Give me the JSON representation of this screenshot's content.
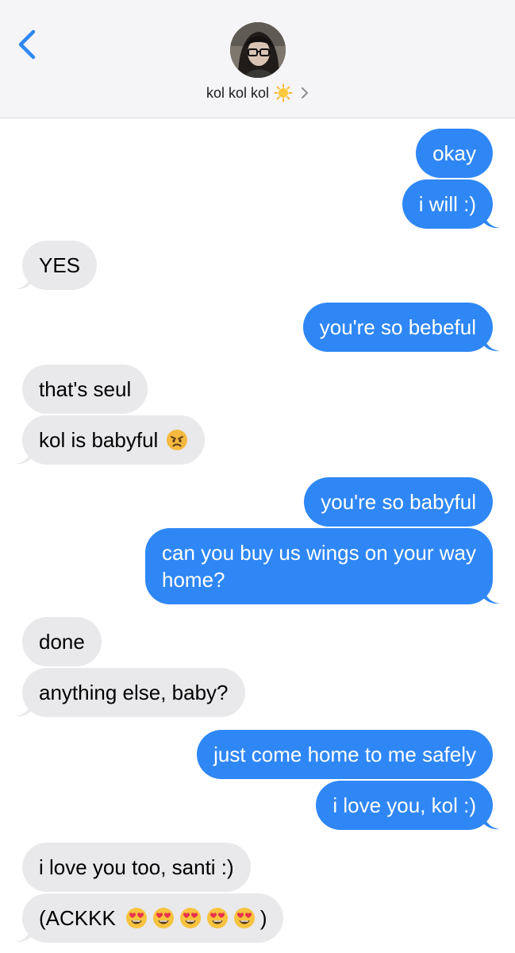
{
  "header": {
    "contact_name": "kol kol kol",
    "contact_emoji": "sun-icon",
    "back_icon": "chevron-left-icon",
    "detail_icon": "chevron-right-icon"
  },
  "colors": {
    "sent_bubble": "#2f87f5",
    "received_bubble": "#e9e9eb",
    "accent": "#2f87f5"
  },
  "messages": [
    {
      "side": "sent",
      "text": "okay"
    },
    {
      "side": "sent",
      "text": "i will :)"
    },
    {
      "side": "received",
      "text": "YES"
    },
    {
      "side": "sent",
      "text": "you're so bebeful"
    },
    {
      "side": "received",
      "text": "that's seul"
    },
    {
      "side": "received",
      "text": "kol is babyful",
      "emoji": "angry-face-icon"
    },
    {
      "side": "sent",
      "text": "you're so babyful"
    },
    {
      "side": "sent",
      "text": "can you buy us wings on your way home?"
    },
    {
      "side": "received",
      "text": "done"
    },
    {
      "side": "received",
      "text": "anything else, baby?"
    },
    {
      "side": "sent",
      "text": "just come home to me safely"
    },
    {
      "side": "sent",
      "text": "i love you, kol :)"
    },
    {
      "side": "received",
      "text": "i love you too, santi :)"
    },
    {
      "side": "received",
      "text": "(ACKKK",
      "text_end": ")",
      "emoji": "heart-eyes-icon",
      "emoji_count": 5
    }
  ]
}
